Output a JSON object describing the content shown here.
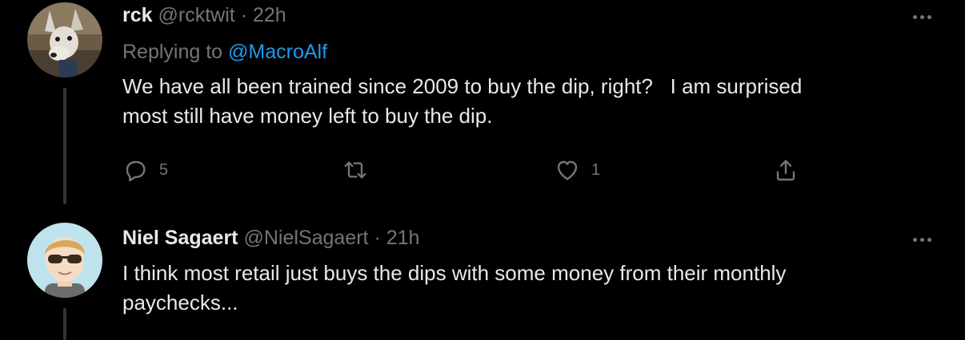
{
  "tweets": [
    {
      "name": "rck",
      "handle": "@rcktwit",
      "dot": "·",
      "time": "22h",
      "replying_prefix": "Replying to",
      "replying_to": "@MacroAlf",
      "lines": [
        "We have all been trained since 2009 to buy the dip, right?   I am surprised",
        "most still have money left to buy the dip."
      ],
      "reply_count": "5",
      "retweet_count": "",
      "like_count": "1",
      "avatar_icon": "dog-avatar"
    },
    {
      "name": "Niel Sagaert",
      "handle": "@NielSagaert",
      "dot": "·",
      "time": "21h",
      "lines": [
        "I think most retail just buys the dips with some money from their monthly",
        "paychecks..."
      ],
      "avatar_icon": "cartoon-man-sunglasses-avatar"
    }
  ],
  "colors": {
    "background": "#000000",
    "text": "#e7e9ea",
    "muted": "#71767b",
    "link": "#1d9bf0",
    "thread_line": "#333639"
  }
}
